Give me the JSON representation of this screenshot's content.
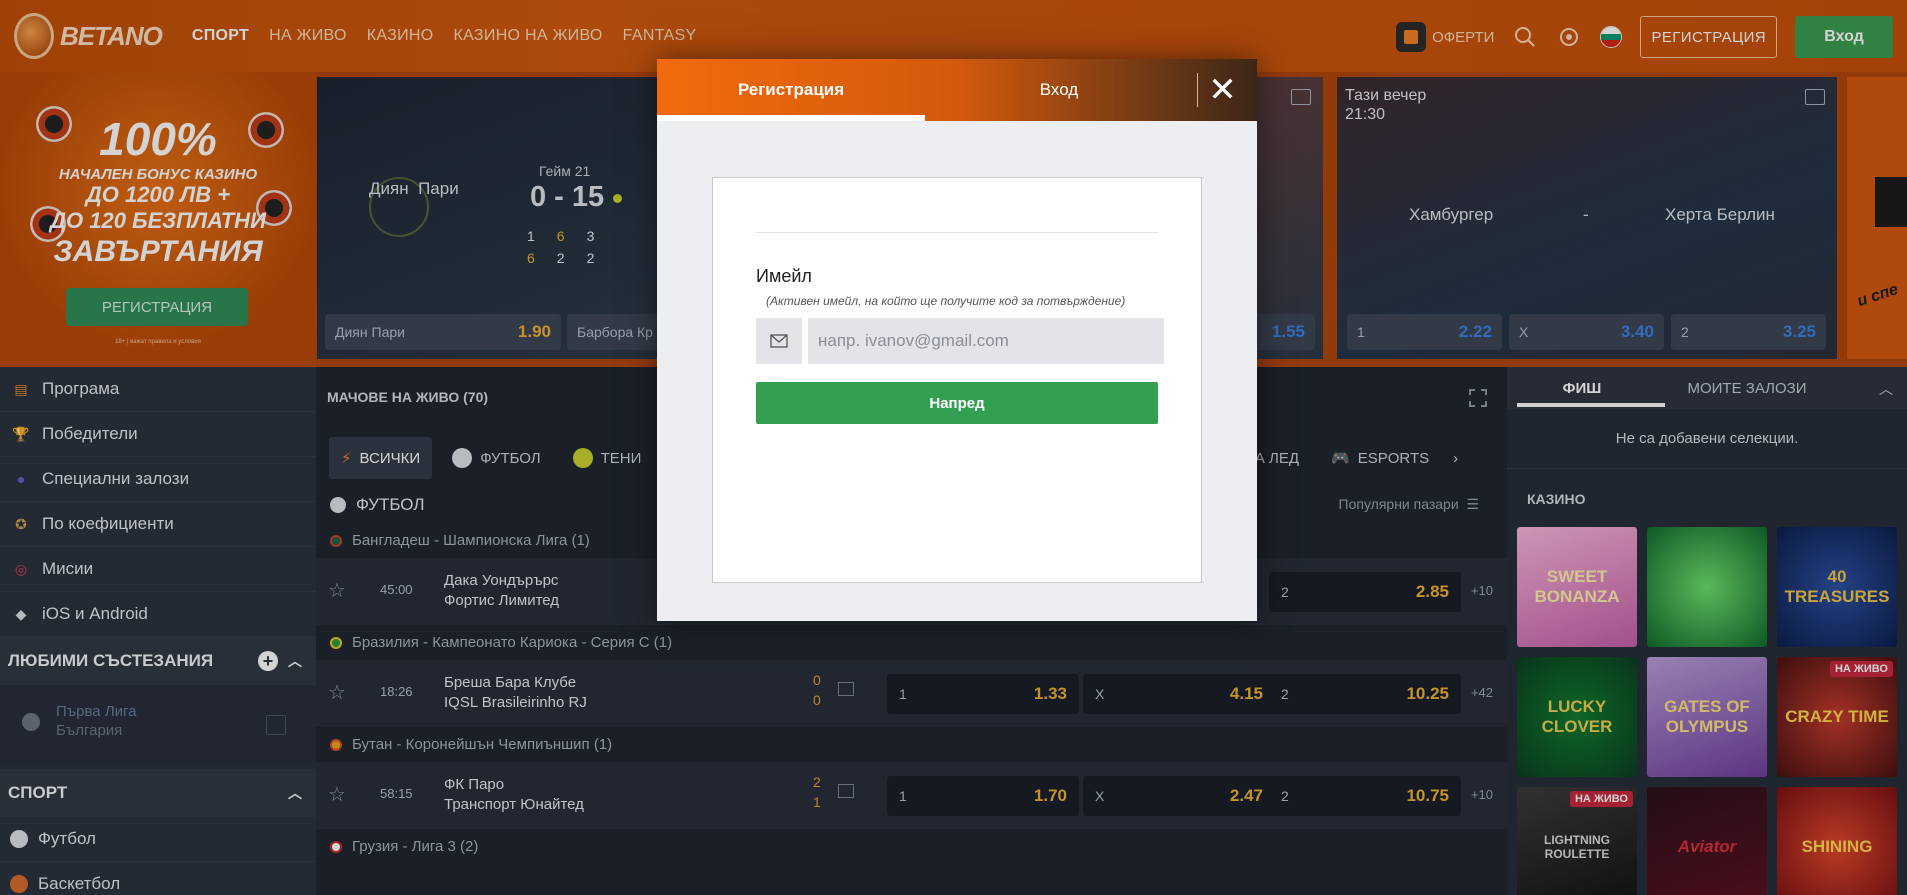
{
  "header": {
    "logo_text": "BETANO",
    "nav": [
      "СПОРТ",
      "НА ЖИВО",
      "КАЗИНО",
      "КАЗИНО НА ЖИВО",
      "FANTASY"
    ],
    "offers_label": "ОФЕРТИ",
    "register_label": "РЕГИСТРАЦИЯ",
    "login_label": "Вход"
  },
  "promo": {
    "line1": "100%",
    "line2": "НАЧАЛЕН БОНУС КАЗИНО",
    "line3": "ДО 1200 ЛВ +",
    "line4": "ДО 120 БЕЗПЛАТНИ",
    "line5": "ЗАВЪРТАНИЯ",
    "button": "РЕГИСТРАЦИЯ",
    "fine": "18+ | важат правила и условия"
  },
  "tennis_card": {
    "player1": "Диян",
    "player2": "Пари",
    "game_label": "Гейм 21",
    "score": "0 - 15",
    "sets_row1": [
      "1",
      "6",
      "3"
    ],
    "sets_row2": [
      "6",
      "2",
      "2"
    ],
    "odd1_name": "Диян Пари",
    "odd1_val": "1.90",
    "odd2_name": "Барбора Кр"
  },
  "match_card_mid": {
    "odd_val": "1.55"
  },
  "football_card": {
    "when": "Тази вечер",
    "time": "21:30",
    "home": "Хамбургер",
    "sep": "-",
    "away": "Херта Берлин",
    "odds": [
      {
        "label": "1",
        "value": "2.22"
      },
      {
        "label": "X",
        "value": "3.40"
      },
      {
        "label": "2",
        "value": "3.25"
      }
    ]
  },
  "right_promo_text": "и спе",
  "modal": {
    "tab_register": "Регистрация",
    "tab_login": "Вход",
    "close": "✕",
    "email_label": "Имейл",
    "email_hint": "(Активен имейл, на който ще получите код за потвърждение)",
    "email_placeholder": "напр. ivanov@gmail.com",
    "next_button": "Напред"
  },
  "sidebar": {
    "items": [
      "Програма",
      "Победители",
      "Специални залози",
      "По коефициенти",
      "Мисии",
      "iOS и Android"
    ],
    "favorites_title": "ЛЮБИМИ СЪСТЕЗАНИЯ",
    "favorite_name": "Първа Лига",
    "favorite_country": "България",
    "sport_title": "СПОРТ",
    "sports": [
      "Футбол",
      "Баскетбол"
    ]
  },
  "live": {
    "title": "МАЧОВЕ НА ЖИВО (70)",
    "tabs": [
      "ВСИЧКИ",
      "ФУТБОЛ",
      "ТЕНИ",
      "НА ЛЕД",
      "ESPORTS"
    ],
    "section_title": "ФУТБОЛ",
    "popular_markets": "Популярни пазари",
    "leagues": [
      {
        "name": "Бангладеш - Шампионска Лига (1)",
        "match": {
          "time": "45:00",
          "team1": "Дака Уондърърс",
          "team2": "Фортис Лимитед",
          "score1": "",
          "score2": "",
          "odds": [
            {
              "l": "2",
              "v": "2.85"
            }
          ],
          "more": "+10"
        }
      },
      {
        "name": "Бразилия - Кампеонато Кариока - Серия С (1)",
        "match": {
          "time": "18:26",
          "team1": "Бреша Бара Клубе",
          "team2": "IQSL Brasileirinho RJ",
          "score1": "0",
          "score2": "0",
          "odds": [
            {
              "l": "1",
              "v": "1.33"
            },
            {
              "l": "X",
              "v": "4.15"
            },
            {
              "l": "2",
              "v": "10.25"
            }
          ],
          "more": "+42"
        }
      },
      {
        "name": "Бутан - Коронейшън Чемпиъншип (1)",
        "match": {
          "time": "58:15",
          "team1": "ФК Паро",
          "team2": "Транспорт Юнайтед",
          "score1": "2",
          "score2": "1",
          "odds": [
            {
              "l": "1",
              "v": "1.70"
            },
            {
              "l": "X",
              "v": "2.47"
            },
            {
              "l": "2",
              "v": "10.75"
            }
          ],
          "more": "+10"
        }
      },
      {
        "name": "Грузия - Лига 3 (2)"
      }
    ]
  },
  "betslip": {
    "tab1": "ФИШ",
    "tab2": "МОИТЕ ЗАЛОЗИ",
    "empty": "Не са добавени селекции.",
    "casino_title": "КАЗИНО",
    "live_badge": "НА ЖИВО",
    "games": [
      "SWEET BONANZA",
      "",
      "40 TREASURES",
      "LUCKY CLOVER",
      "GATES OF OLYMPUS",
      "CRAZY TIME",
      "LIGHTNING ROULETTE",
      "Aviator",
      "SHINING"
    ]
  },
  "colors": {
    "brand_orange": "#d1580c",
    "green": "#33a051",
    "odds_yellow": "#f0b22b",
    "odds_blue": "#3d7fe0"
  }
}
